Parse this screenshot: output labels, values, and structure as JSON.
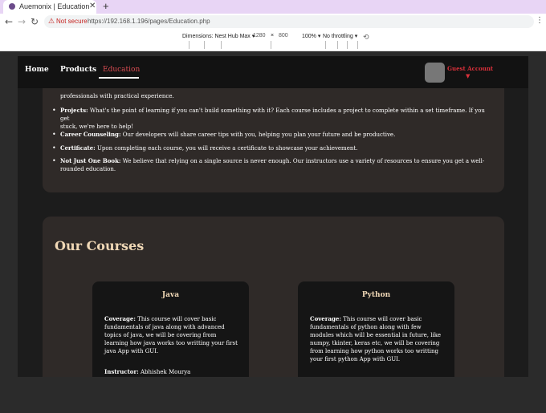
{
  "browser": {
    "tab_title": "Auemonix | Education",
    "new_tab": "+",
    "not_secure": "Not secure",
    "url": "https://192.168.1.196/pages/Education.php"
  },
  "devtools": {
    "dimensions_label": "Dimensions: Nest Hub Max",
    "width": "1280",
    "times": "×",
    "height": "800",
    "zoom": "100%",
    "throttling": "No throttling"
  },
  "header": {
    "nav": [
      "Home",
      "Products",
      "Education"
    ],
    "account": "Guest Account",
    "caret": "▼"
  },
  "features": {
    "partial_top": "professionals with practical experience.",
    "items": [
      {
        "title": "Projects:",
        "text": " What's the point of learning if you can't build something with it? Each course includes a project to complete within a set timeframe. If you get",
        "text2": "stuck, we're here to help!"
      },
      {
        "title": "Career Counseling:",
        "text": " Our developers will share career tips with you, helping you plan your future and be productive."
      },
      {
        "title": "Certificate:",
        "text": " Upon completing each course, you will receive a certificate to showcase your achievement."
      },
      {
        "title": "Not Just One Book:",
        "text": " We believe that relying on a single source is never enough. Our instructors use a variety of resources to ensure you get a well-",
        "text2": "rounded education."
      }
    ]
  },
  "courses": {
    "title": "Our Courses",
    "list": [
      {
        "name": "Java",
        "coverage_label": "Coverage:",
        "coverage": " This course will cover basic fundamentals of java along with advanced topics of java, we will be covering from learning how java works too writting your first java App with GUI.",
        "instructor_label": "Instructor:",
        "instructor": " Abhishek Mourya"
      },
      {
        "name": "Python",
        "coverage_label": "Coverage:",
        "coverage": " This course will cover basic fundamentals of python along with few modules which will be essential in future, like numpy, tkinter, keras etc, we will be covering from learning how python works too writting your first python App with GUI."
      }
    ]
  }
}
